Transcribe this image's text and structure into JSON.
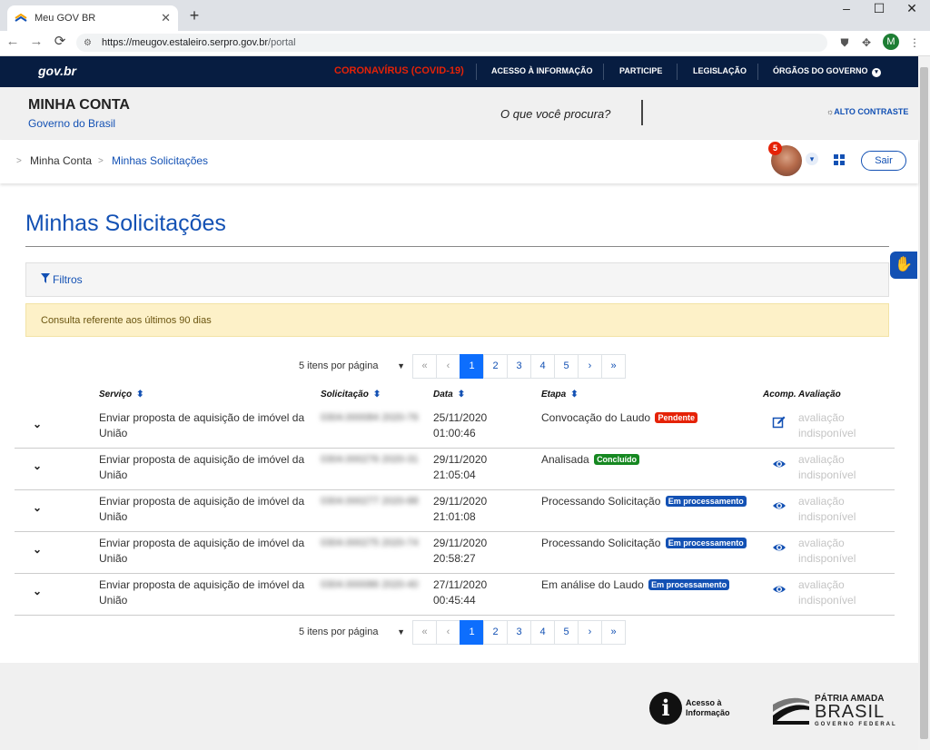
{
  "browser": {
    "tab_title": "Meu GOV BR",
    "tab_close": "✕",
    "new_tab": "+",
    "url_host": "https://meugov.estaleiro.serpro.gov.br",
    "url_path": "/portal",
    "profile_initial": "M"
  },
  "govbar": {
    "logo": "gov.br",
    "links": [
      "CORONAVÍRUS (COVID-19)",
      "ACESSO À INFORMAÇÃO",
      "PARTICIPE",
      "LEGISLAÇÃO",
      "ÓRGÃOS DO GOVERNO"
    ]
  },
  "header": {
    "title": "MINHA CONTA",
    "subtitle": "Governo do Brasil",
    "search_prompt": "O que você procura?",
    "contrast": "ALTO CONTRASTE"
  },
  "breadcrumb": {
    "home": "Minha Conta",
    "current": "Minhas Solicitações"
  },
  "user": {
    "notifications": "5",
    "logout": "Sair"
  },
  "page": {
    "title": "Minhas Solicitações",
    "filters": "Filtros",
    "notice": "Consulta referente aos últimos 90 dias"
  },
  "pagination": {
    "per_page": "5 itens por página",
    "first": "«",
    "prev": "‹",
    "next": "›",
    "last": "»",
    "pages": [
      "1",
      "2",
      "3",
      "4",
      "5"
    ]
  },
  "table": {
    "headers": {
      "servico": "Serviço",
      "solicitacao": "Solicitação",
      "data": "Data",
      "etapa": "Etapa",
      "acomp": "Acomp.",
      "avaliacao": "Avaliação"
    },
    "rows": [
      {
        "servico": "Enviar proposta de aquisição de imóvel da União",
        "solicitacao": "0304.000084 2020-76",
        "data": "25/11/2020 01:00:46",
        "etapa": "Convocação do Laudo",
        "status": "Pendente",
        "status_color": "#e52207",
        "acomp": "edit-icon",
        "avaliacao": "avaliação indisponível"
      },
      {
        "servico": "Enviar proposta de aquisição de imóvel da União",
        "solicitacao": "0304.000276 2020-31",
        "data": "29/11/2020 21:05:04",
        "etapa": "Analisada",
        "status": "Concluído",
        "status_color": "#168821",
        "acomp": "eye-icon",
        "avaliacao": "avaliação indisponível"
      },
      {
        "servico": "Enviar proposta de aquisição de imóvel da União",
        "solicitacao": "0304.000277 2020-88",
        "data": "29/11/2020 21:01:08",
        "etapa": "Processando Solicitação",
        "status": "Em processamento",
        "status_color": "#1351b4",
        "acomp": "eye-icon",
        "avaliacao": "avaliação indisponível"
      },
      {
        "servico": "Enviar proposta de aquisição de imóvel da União",
        "solicitacao": "0304.000275 2020-74",
        "data": "29/11/2020 20:58:27",
        "etapa": "Processando Solicitação",
        "status": "Em processamento",
        "status_color": "#1351b4",
        "acomp": "eye-icon",
        "avaliacao": "avaliação indisponível"
      },
      {
        "servico": "Enviar proposta de aquisição de imóvel da União",
        "solicitacao": "0304.000086 2020-40",
        "data": "27/11/2020 00:45:44",
        "etapa": "Em análise do Laudo",
        "status": "Em processamento",
        "status_color": "#1351b4",
        "acomp": "eye-icon",
        "avaliacao": "avaliação indisponível"
      }
    ]
  },
  "footer": {
    "acesso_line1": "Acesso à",
    "acesso_line2": "Informação",
    "brasil_line1": "PÁTRIA AMADA",
    "brasil_line2": "BRASIL",
    "brasil_line3": "GOVERNO FEDERAL"
  }
}
